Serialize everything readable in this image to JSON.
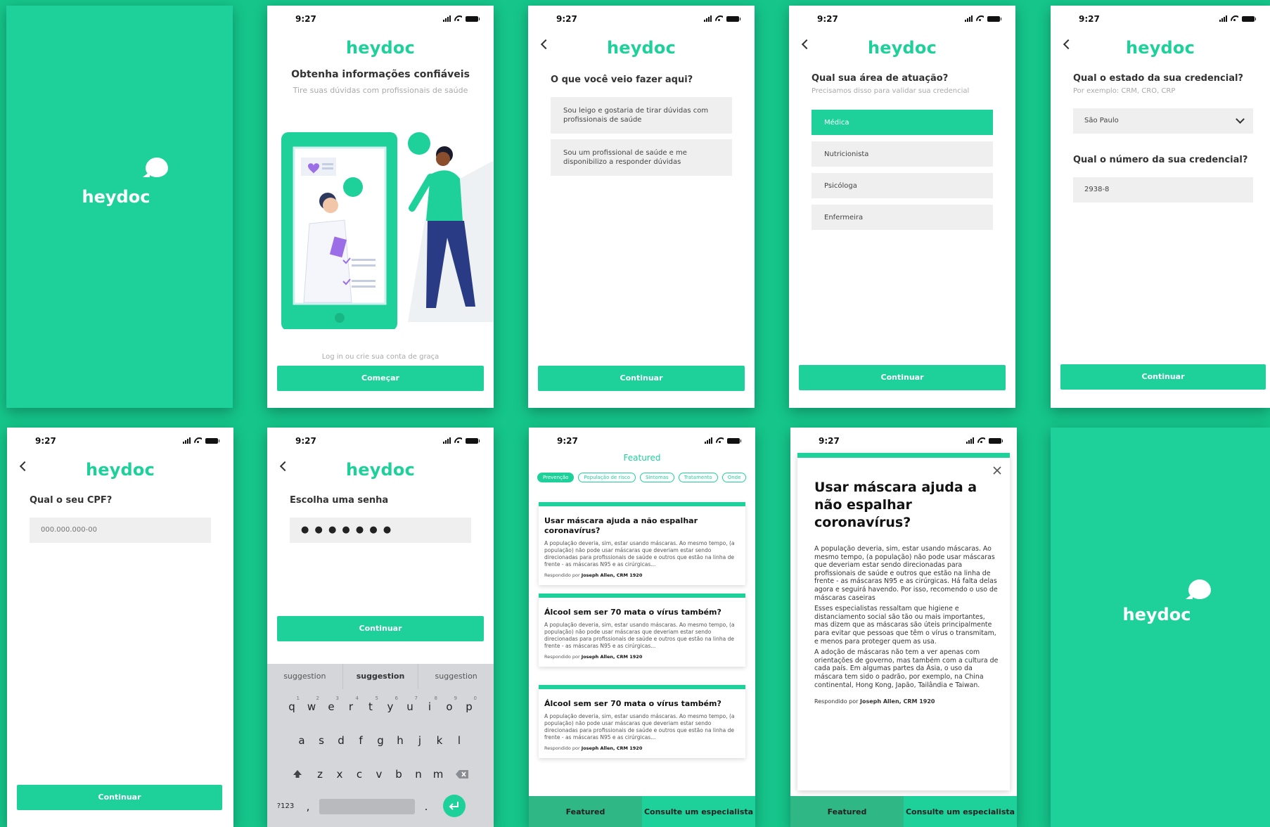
{
  "brand": {
    "name": "heydoc",
    "accent": "#1ed19a"
  },
  "status": {
    "time": "9:27"
  },
  "screen2": {
    "title": "Obtenha informações confiáveis",
    "subtitle": "Tire suas dúvidas com profissionais de saúde",
    "login_hint": "Log in ou crie sua conta de graça",
    "button": "Começar"
  },
  "screen3": {
    "question": "O que você veio fazer aqui?",
    "options": [
      "Sou leigo e gostaria de tirar dúvidas com profissionais de saúde",
      "Sou um profissional de saúde e me disponibilizo a responder dúvidas"
    ],
    "button": "Continuar"
  },
  "screen4": {
    "question": "Qual sua área de atuação?",
    "hint": "Precisamos disso para validar sua credencial",
    "options": [
      "Médica",
      "Nutricionista",
      "Psicóloga",
      "Enfermeira"
    ],
    "button": "Continuar"
  },
  "screen5": {
    "question1": "Qual o estado da sua credencial?",
    "hint": "Por exemplo: CRM, CRO, CRP",
    "state_value": "São Paulo",
    "question2": "Qual o número da sua credencial?",
    "number_value": "2938-8",
    "button": "Continuar"
  },
  "screen6": {
    "question": "Qual o seu CPF?",
    "placeholder": "000.000.000-00",
    "button": "Continuar"
  },
  "screen7": {
    "question": "Escolha uma senha",
    "password_mask": "● ● ● ● ● ● ●",
    "button": "Continuar",
    "suggestions": [
      "suggestion",
      "suggestion",
      "suggestion"
    ],
    "row1": [
      "q",
      "w",
      "e",
      "r",
      "t",
      "y",
      "u",
      "i",
      "o",
      "p"
    ],
    "row1_nums": [
      "1",
      "2",
      "3",
      "4",
      "5",
      "6",
      "7",
      "8",
      "9",
      "0"
    ],
    "row2": [
      "a",
      "s",
      "d",
      "f",
      "g",
      "h",
      "j",
      "k",
      "l"
    ],
    "row3": [
      "z",
      "x",
      "c",
      "v",
      "b",
      "n",
      "m"
    ],
    "numkey": "?123",
    "comma": ",",
    "period": "."
  },
  "screen8": {
    "header": "Featured",
    "chips": [
      "Prevenção",
      "População de risco",
      "Sintomas",
      "Tratamento",
      "Onde"
    ],
    "cards": [
      {
        "title": "Usar máscara ajuda a não espalhar coronavírus?",
        "body": "A população deveria, sim, estar usando máscaras. Ao mesmo tempo, (a população) não pode usar máscaras que deveriam estar sendo direcionadas para profissionais de saúde e outros que estão na linha de frente - as máscaras N95 e as cirúrgicas...",
        "by_label": "Respondido por",
        "by_name": "Joseph Allen, CRM 1920"
      },
      {
        "title": "Álcool sem ser 70 mata o vírus também?",
        "body": "A população deveria, sim, estar usando máscaras. Ao mesmo tempo, (a população) não pode usar máscaras que deveriam estar sendo direcionadas para profissionais de saúde e outros que estão na linha de frente - as máscaras N95 e as cirúrgicas...",
        "by_label": "Respondido por",
        "by_name": "Joseph Allen, CRM 1920"
      },
      {
        "title": "Álcool sem ser 70 mata o vírus também?",
        "body": "A população deveria, sim, estar usando máscaras. Ao mesmo tempo, (a população) não pode usar máscaras que deveriam estar sendo direcionadas para profissionais de saúde e outros que estão na linha de frente - as máscaras N95 e as cirúrgicas...",
        "by_label": "Respondido por",
        "by_name": "Joseph Allen, CRM 1920"
      }
    ],
    "tabs": [
      "Featured",
      "Consulte um especialista"
    ]
  },
  "screen9": {
    "title": "Usar máscara ajuda a não espalhar coronavírus?",
    "p1": "A população deveria, sim, estar usando máscaras. Ao mesmo tempo, (a população) não pode usar máscaras que deveriam estar sendo direcionadas para profissionais de saúde e outros que estão na linha de frente - as máscaras N95 e as cirúrgicas. Há falta delas agora e seguirá havendo. Por isso, recomendo o uso de máscaras caseiras",
    "p2": "Esses especialistas ressaltam que higiene e distanciamento social são tão ou mais importantes, mas dizem que as máscaras são úteis principalmente para evitar que pessoas que têm o vírus o transmitam, e menos para proteger quem as usa.",
    "p3": "A adoção de máscaras não tem a ver apenas com orientações de governo, mas também com a cultura de cada país. Em algumas partes da Ásia, o uso da máscara tem sido o padrão, por exemplo, na China continental, Hong Kong, Japão, Tailândia e Taiwan.",
    "by_label": "Respondido por",
    "by_name": "Joseph Allen, CRM 1920",
    "tabs": [
      "Featured",
      "Consulte um especialista"
    ]
  }
}
